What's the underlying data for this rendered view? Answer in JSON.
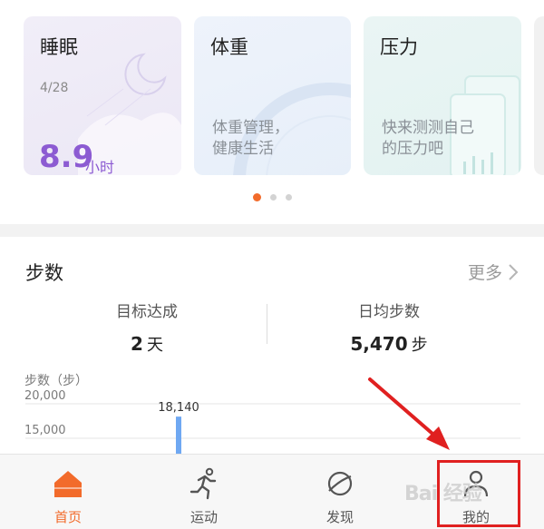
{
  "cards": [
    {
      "title": "睡眠",
      "date": "4/28",
      "value": "8.9",
      "unit": "小时"
    },
    {
      "title": "体重",
      "desc": "体重管理，\n健康生活"
    },
    {
      "title": "压力",
      "desc": "快来测测自己\n的压力吧"
    }
  ],
  "pager": {
    "count": 3,
    "active": 0
  },
  "steps": {
    "title": "步数",
    "more_label": "更多",
    "goal_label": "目标达成",
    "goal_value": "2",
    "goal_unit": "天",
    "avg_label": "日均步数",
    "avg_value": "5,470",
    "avg_unit": "步"
  },
  "chart_data": {
    "type": "bar",
    "ylabel": "步数（步）",
    "yticks": [
      "20,000",
      "15,000"
    ],
    "ytick_values": [
      20000,
      15000
    ],
    "values": [
      18140
    ],
    "data_labels": [
      "18,140"
    ],
    "bar_color": "#6fa8f2"
  },
  "nav": {
    "items": [
      {
        "label": "首页",
        "icon": "home-icon",
        "active": true
      },
      {
        "label": "运动",
        "icon": "running-icon",
        "active": false
      },
      {
        "label": "发现",
        "icon": "planet-icon",
        "active": false
      },
      {
        "label": "我的",
        "icon": "person-icon",
        "active": false
      }
    ]
  },
  "overlay": {
    "watermark": "Bai 经验",
    "annotation_color": "#e02020"
  },
  "colors": {
    "accent": "#f26b2b",
    "sleep": "#8c5bd2"
  }
}
